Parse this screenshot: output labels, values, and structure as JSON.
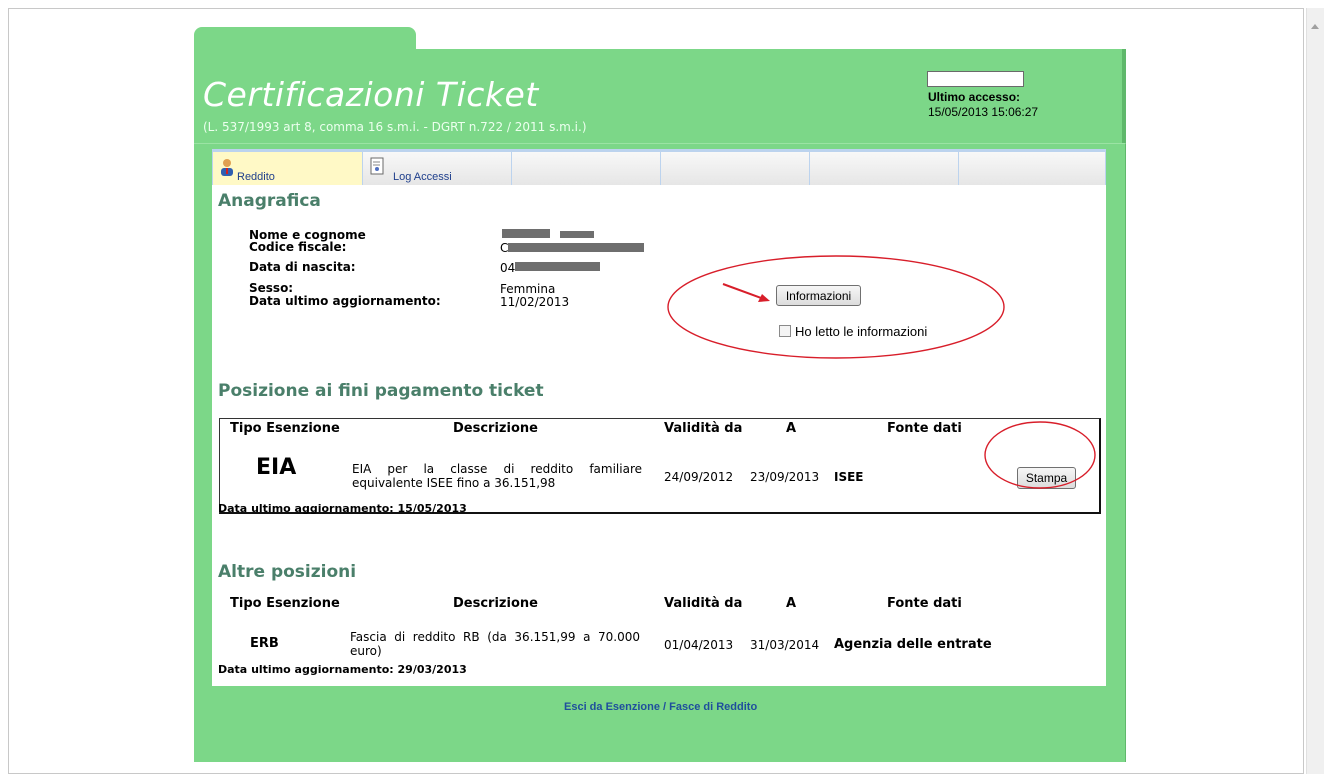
{
  "header": {
    "title": "Certificazioni Ticket",
    "subtitle": "(L. 537/1993 art 8, comma 16 s.m.i. - DGRT n.722 / 2011  s.m.i.)",
    "last_access_label": "Ultimo accesso:",
    "last_access_value": "15/05/2013 15:06:27"
  },
  "tabs": [
    {
      "label": "Reddito",
      "icon": "user-icon",
      "active": true
    },
    {
      "label": "Log Accessi",
      "icon": "document-icon",
      "active": false
    }
  ],
  "anagrafica": {
    "title": "Anagrafica",
    "fields": [
      {
        "label": "Nome e cognome",
        "value": ""
      },
      {
        "label": "Codice fiscale:",
        "value": "C"
      },
      {
        "label": "Data di nascita:",
        "value": "04"
      },
      {
        "label": "Sesso:",
        "value": "Femmina"
      },
      {
        "label": "Data ultimo aggiornamento:",
        "value": "11/02/2013"
      }
    ],
    "info_button": "Informazioni",
    "read_checkbox_label": "Ho letto le informazioni"
  },
  "posizione": {
    "title": "Posizione ai fini pagamento ticket",
    "columns": [
      "Tipo Esenzione",
      "Descrizione",
      "Validità da",
      "A",
      "Fonte dati"
    ],
    "row": {
      "code": "EIA",
      "description": "EIA per la classe di reddito familiare equivalente ISEE fino a 36.151,98",
      "from": "24/09/2012",
      "to": "23/09/2013",
      "source": "ISEE"
    },
    "print_button": "Stampa",
    "updated": "Data ultimo aggiornamento: 15/05/2013"
  },
  "altre": {
    "title": "Altre posizioni",
    "columns": [
      "Tipo Esenzione",
      "Descrizione",
      "Validità da",
      "A",
      "Fonte dati"
    ],
    "row": {
      "code": "ERB",
      "description": "Fascia di reddito RB (da 36.151,99 a 70.000 euro)",
      "from": "01/04/2013",
      "to": "31/03/2014",
      "source": "Agenzia delle entrate"
    },
    "updated": "Data ultimo aggiornamento: 29/03/2013"
  },
  "footer": {
    "exit_link": "Esci da Esenzione / Fasce di Reddito"
  },
  "colors": {
    "header_green": "#7cd788",
    "section_title": "#4a7f6a",
    "annotation_red": "#d81e2a",
    "link_blue": "#1f4f9c"
  }
}
